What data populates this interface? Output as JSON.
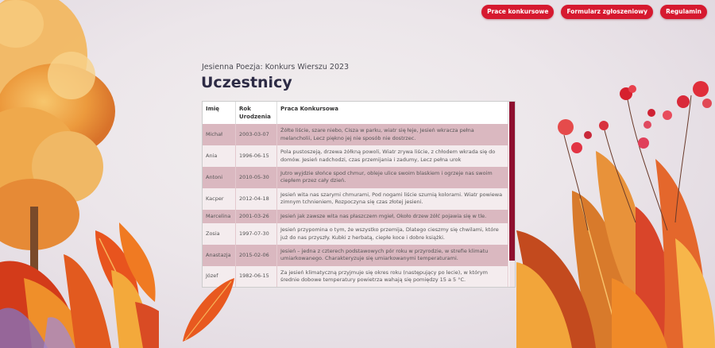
{
  "nav": {
    "buttons": [
      "Prace konkursowe",
      "Formularz zgłoszeniowy",
      "Regulamin"
    ]
  },
  "header": {
    "subtitle": "Jesienna Poezja: Konkurs Wierszu 2023",
    "title": "Uczestnicy"
  },
  "table": {
    "columns": [
      "Imię",
      "Rok Urodzenia",
      "Praca Konkursowa"
    ],
    "rows": [
      [
        "Michał",
        "2003-03-07",
        "Żółte liście, szare niebo, Cisza w parku, wiatr się łeje, Jesień wkracza pełna melancholii, Lecz piękno jej nie sposób nie dostrzec."
      ],
      [
        "Ania",
        "1996-06-15",
        "Pola pustoszeją, drzewa żółkną powoli, Wiatr zrywa liście, z chłodem wkrada się do domów. Jesień nadchodzi, czas przemijania i zadumy, Lecz pełna urok"
      ],
      [
        "Antoni",
        "2010-05-30",
        "Jutro wyjdzie słońce spod chmur, obleje ulice swoim blaskiem i ogrzeje nas swoim ciepłem przez cały dzień."
      ],
      [
        "Kacper",
        "2012-04-18",
        "Jesień wita nas szarymi chmurami, Pod nogami liście szumią kolorami. Wiatr powiewa zimnym tchnieniem, Rozpoczyna się czas złotej jesieni."
      ],
      [
        "Marcelina",
        "2001-03-26",
        "Jesień jak zawsze wita nas płaszczem mgieł, Około drzew żółć pojawia się w tle."
      ],
      [
        "Zosia",
        "1997-07-30",
        "Jesień przypomina o tym, że wszystko przemija, Dlatego cieszmy się chwilami, które już do nas przyszły. Kubki z herbatą, ciepłe koce i dobre książki."
      ],
      [
        "Anastazja",
        "2015-02-06",
        "Jesień – jedna z czterech podstawowych pór roku w przyrodzie, w strefie klimatu umiarkowanego. Charakteryzuje się umiarkowanymi temperaturami."
      ],
      [
        "Józef",
        "1982-06-15",
        "Za jesień klimatyczną przyjmuje się okres roku (następujący po lecie), w którym średnie dobowe temperatury powietrza wahają się pomiędzy 15 a 5 °C."
      ]
    ]
  },
  "colors": {
    "accent": "#d6192f",
    "title": "#2d2b45",
    "row_odd": "#dab8c0",
    "row_even": "#f4ecee",
    "scrollbar_thumb": "#8e0f2f"
  }
}
